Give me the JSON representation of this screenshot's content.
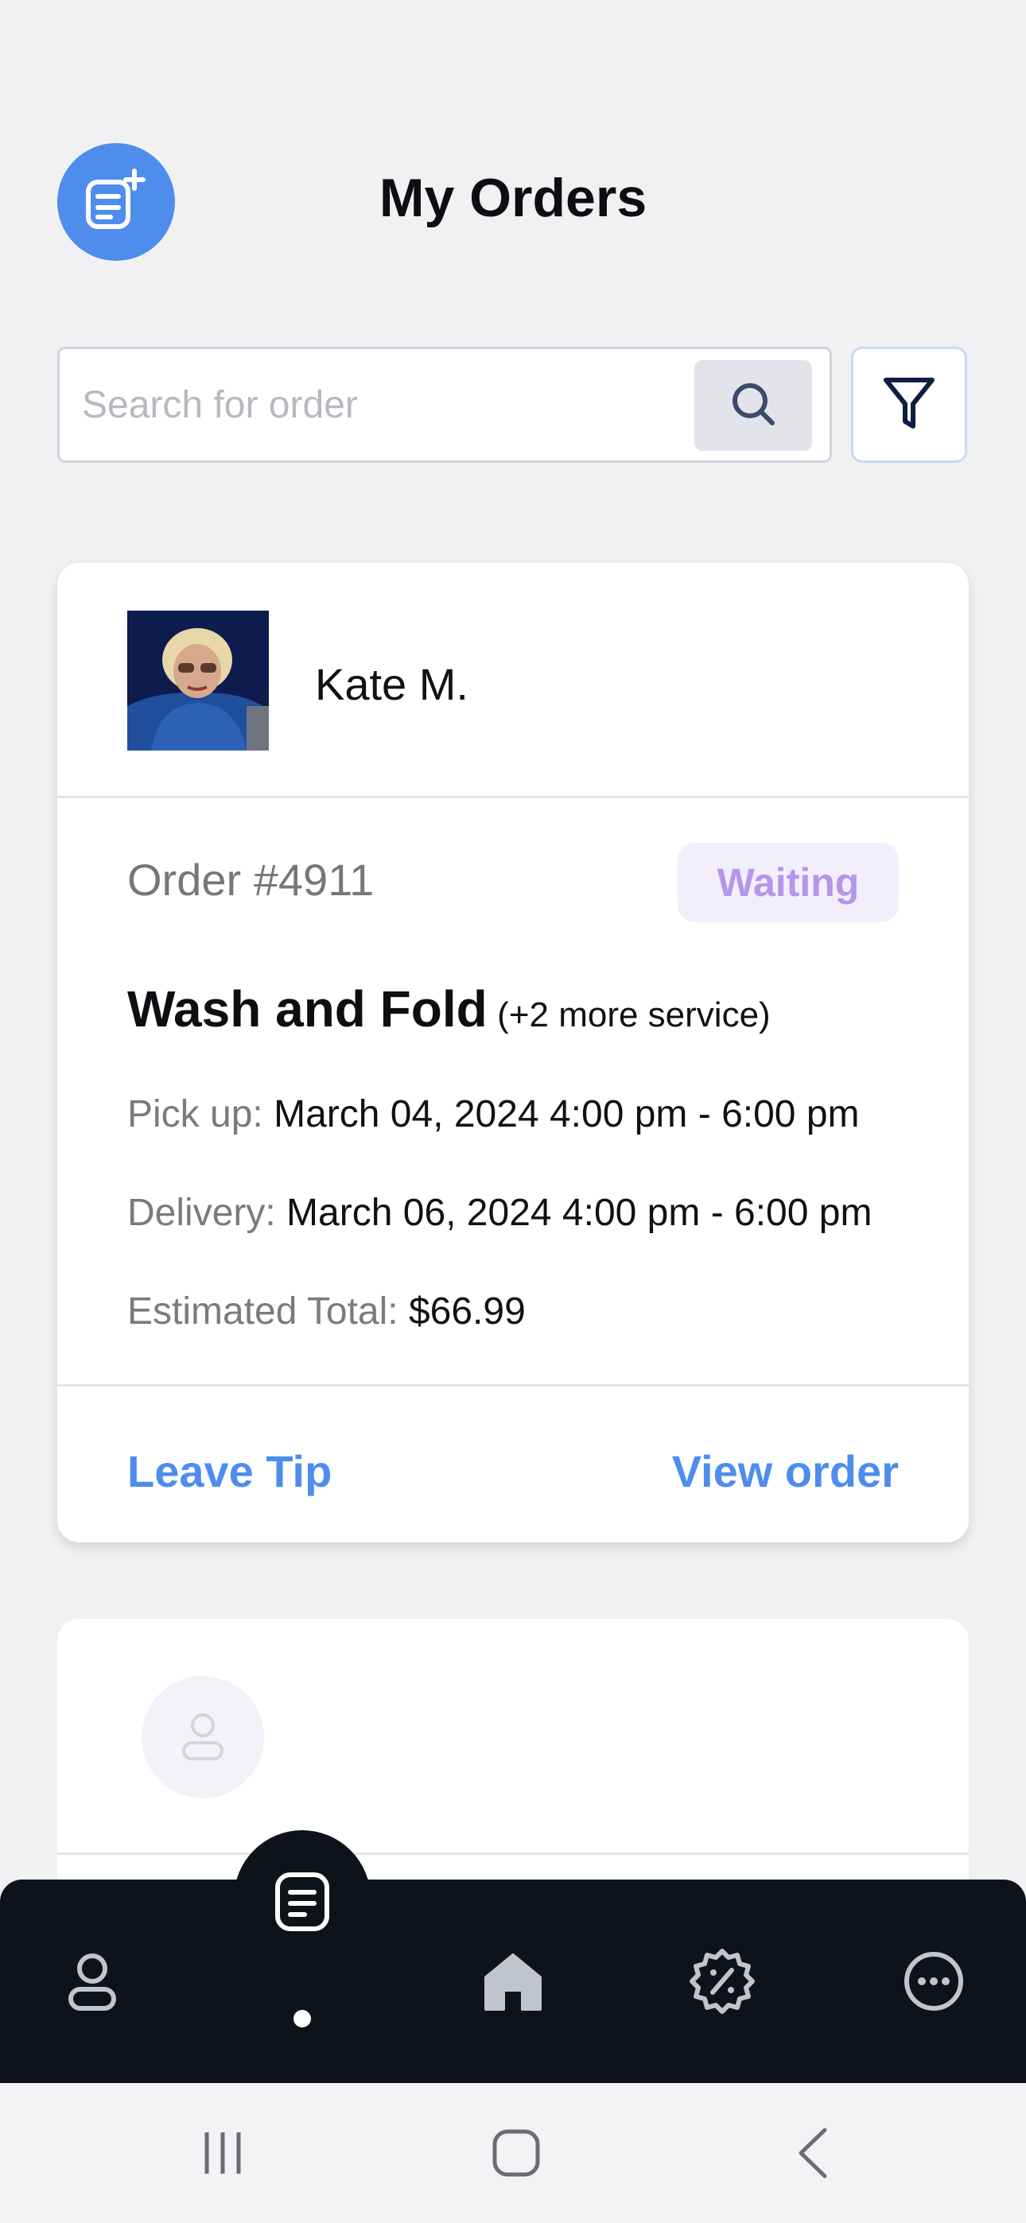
{
  "header": {
    "title": "My Orders",
    "new_order_icon": "clipboard-plus-icon"
  },
  "search": {
    "placeholder": "Search for order",
    "search_icon": "search-icon",
    "filter_icon": "filter-icon"
  },
  "orders": [
    {
      "customer_name": "Kate M.",
      "order_number": "Order #4911",
      "status": "Waiting",
      "service": "Wash and Fold",
      "service_extra": "(+2 more service)",
      "pickup_label": "Pick up:",
      "pickup_value": "March 04, 2024 4:00 pm - 6:00 pm",
      "delivery_label": "Delivery:",
      "delivery_value": "March 06, 2024 4:00 pm - 6:00 pm",
      "total_label": "Estimated Total:",
      "total_value": "$66.99",
      "leave_tip_label": "Leave Tip",
      "view_order_label": "View order"
    }
  ],
  "bottom_nav": {
    "items": [
      {
        "icon": "profile-icon"
      },
      {
        "icon": "orders-icon",
        "active": true
      },
      {
        "icon": "home-icon"
      },
      {
        "icon": "discount-icon"
      },
      {
        "icon": "more-icon"
      }
    ]
  },
  "system_nav": {
    "items": [
      "recent-apps-icon",
      "home-button-icon",
      "back-icon"
    ]
  },
  "colors": {
    "accent": "#4f8ded",
    "status_waiting_bg": "#f3eefc",
    "status_waiting_text": "#b496ec",
    "nav_bg": "#0d121b"
  }
}
